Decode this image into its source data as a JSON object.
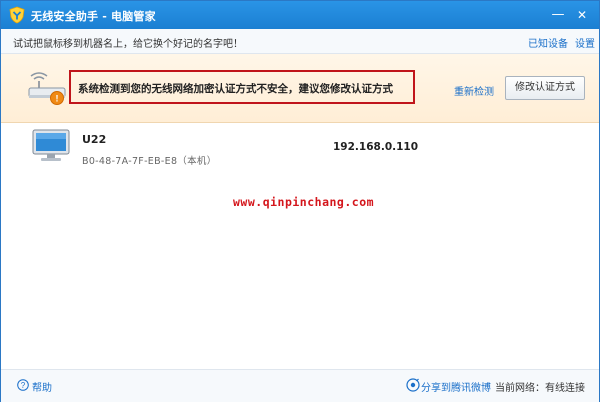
{
  "titlebar": {
    "title": "无线安全助手 - 电脑管家",
    "minimize": "—",
    "close": "✕"
  },
  "hintbar": {
    "text": "试试把鼠标移到机器名上，给它换个好记的名字吧！",
    "known_devices": "已知设备",
    "settings": "设置"
  },
  "banner": {
    "warning": "系统检测到您的无线网络加密认证方式不安全，建议您修改认证方式",
    "recheck": "重新检测",
    "modify_button": "修改认证方式"
  },
  "device": {
    "name": "U22",
    "mac": "B0-48-7A-7F-EB-E8（本机）",
    "ip": "192.168.0.110"
  },
  "watermark": "www.qinpinchang.com",
  "footer": {
    "help": "帮助",
    "share": "分享到腾讯微博",
    "network_status": "当前网络：有线连接"
  },
  "colors": {
    "titlebar": "#1b7fd2",
    "link": "#1a6fc9",
    "warning_border": "#c0151b",
    "banner_bg": "#fff6e8"
  }
}
